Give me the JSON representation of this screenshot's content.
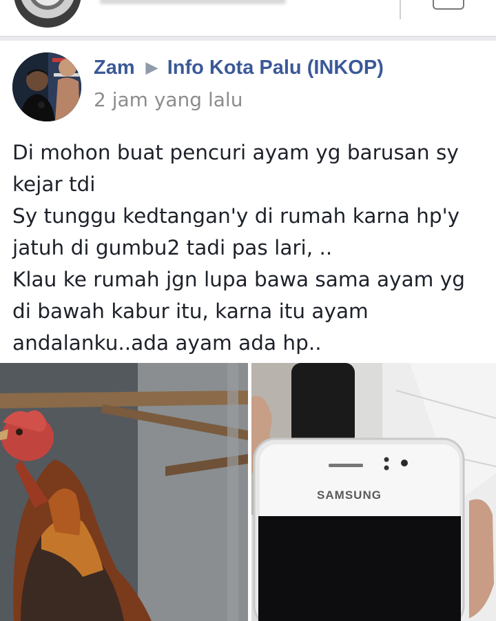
{
  "post": {
    "author": "Zam",
    "group": "Info Kota Palu (INKOP)",
    "timestamp": "2 jam yang lalu",
    "lines": [
      "Di mohon buat pencuri ayam yg barusan sy",
      "kejar tdi",
      "Sy tunggu kedtangan'y di rumah karna hp'y",
      "jatuh di gumbu2 tadi pas lari, ..",
      "Klau ke rumah jgn lupa bawa sama ayam yg",
      "di bawah kabur itu, karna itu ayam",
      "andalanku..ada ayam ada hp.."
    ],
    "phone_brand": "SAMSUNG"
  },
  "icons": {
    "share_arrow": "right-triangle-icon"
  },
  "colors": {
    "author_link": "#3b5998",
    "timestamp": "#8c8c8c",
    "body_text": "#1d2129"
  }
}
